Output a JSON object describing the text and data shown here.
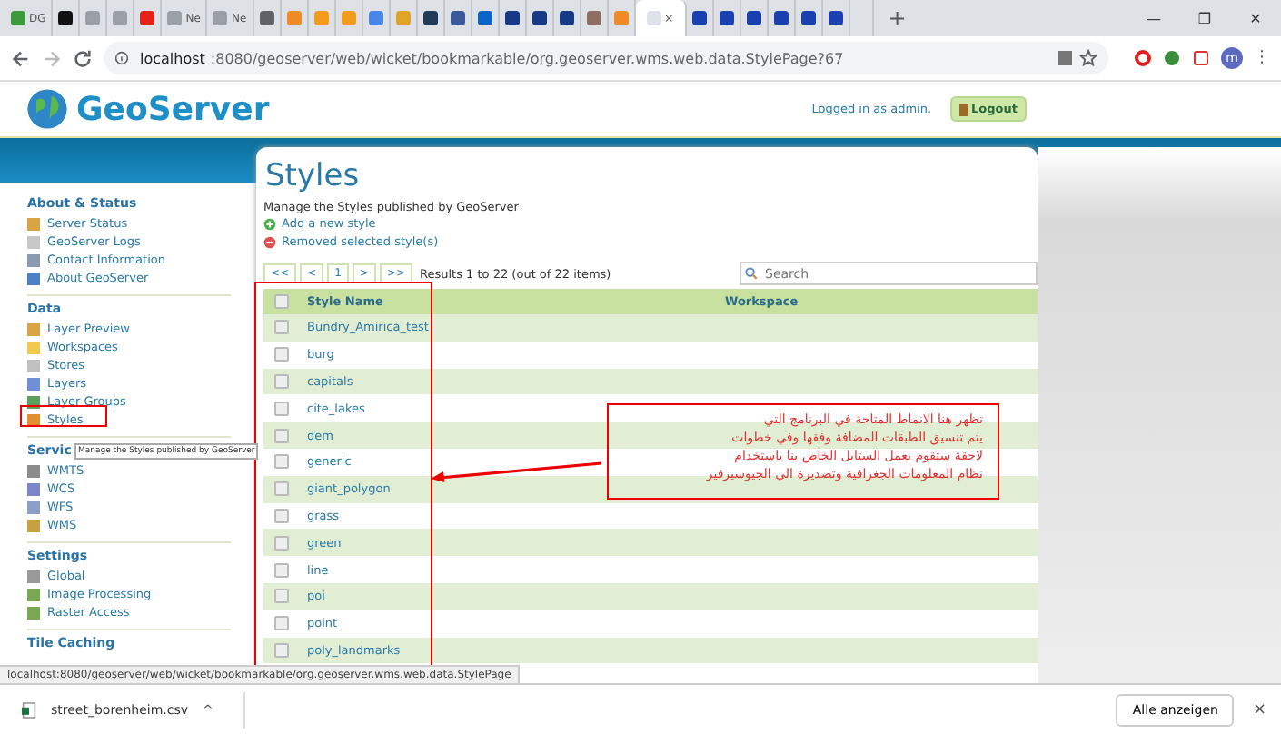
{
  "browser": {
    "tabs": [
      {
        "color": "#3c9a3c",
        "label": "DG",
        "selected": false
      },
      {
        "color": "#111111",
        "selected": false
      },
      {
        "color": "#9aa0a6",
        "selected": false
      },
      {
        "color": "#9aa0a6",
        "selected": false
      },
      {
        "color": "#e62117",
        "selected": false
      },
      {
        "color": "#9aa0a6",
        "label": "Ne",
        "selected": false
      },
      {
        "color": "#9aa0a6",
        "label": "Ne",
        "selected": false
      },
      {
        "color": "#5f6368",
        "selected": false
      },
      {
        "color": "#f08a24",
        "selected": false
      },
      {
        "color": "#f29b1d",
        "selected": false
      },
      {
        "color": "#f29b1d",
        "selected": false
      },
      {
        "color": "#4a86e8",
        "selected": false
      },
      {
        "color": "#e0a526",
        "selected": false
      },
      {
        "color": "#1f3b57",
        "selected": false
      },
      {
        "color": "#3b5998",
        "selected": false
      },
      {
        "color": "#0a64c8",
        "selected": false
      },
      {
        "color": "#173a87",
        "selected": false
      },
      {
        "color": "#173a87",
        "selected": false
      },
      {
        "color": "#173a87",
        "selected": false
      },
      {
        "color": "#8d6e63",
        "selected": false
      },
      {
        "color": "#f08a24",
        "selected": false
      },
      {
        "color": "#dfe3e8",
        "close": "×",
        "selected": true
      },
      {
        "color": "#1a3fb0",
        "selected": false
      },
      {
        "color": "#1a3fb0",
        "selected": false
      },
      {
        "color": "#1a3fb0",
        "selected": false
      },
      {
        "color": "#1a3fb0",
        "selected": false
      },
      {
        "color": "#1a3fb0",
        "selected": false
      },
      {
        "color": "#1a3fb0",
        "selected": false
      },
      {
        "selected": false
      }
    ],
    "new_tab": "+",
    "window_controls": [
      "—",
      "❐",
      "✕"
    ],
    "url_host": "localhost",
    "url_rest": ":8080/geoserver/web/wicket/bookmarkable/org.geoserver.wms.web.data.StylePage?67",
    "avatar": "m",
    "menu": "⋮"
  },
  "header": {
    "logo": "GeoServer",
    "logged_in": "Logged in as admin.",
    "logout": "Logout"
  },
  "sidebar": [
    {
      "title": "About & Status",
      "items": [
        {
          "label": "Server Status",
          "color": "#d9a441"
        },
        {
          "label": "GeoServer Logs",
          "color": "#c8c8c8"
        },
        {
          "label": "Contact Information",
          "color": "#8a9bb0"
        },
        {
          "label": "About GeoServer",
          "color": "#4d7fc4"
        }
      ]
    },
    {
      "title": "Data",
      "items": [
        {
          "label": "Layer Preview",
          "color": "#d9a441"
        },
        {
          "label": "Workspaces",
          "color": "#f2c94c"
        },
        {
          "label": "Stores",
          "color": "#c0c0c0"
        },
        {
          "label": "Layers",
          "color": "#6f8fd6"
        },
        {
          "label": "Layer Groups",
          "color": "#5aa05a"
        },
        {
          "label": "Styles",
          "color": "#e2902e"
        }
      ]
    },
    {
      "title": "Servic",
      "items": [
        {
          "label": "WMTS",
          "color": "#8c8c8c"
        },
        {
          "label": "WCS",
          "color": "#7a86c8"
        },
        {
          "label": "WFS",
          "color": "#8aa0c8"
        },
        {
          "label": "WMS",
          "color": "#c8a040"
        }
      ]
    },
    {
      "title": "Settings",
      "items": [
        {
          "label": "Global",
          "color": "#9a9a9a"
        },
        {
          "label": "Image Processing",
          "color": "#7aa850"
        },
        {
          "label": "Raster Access",
          "color": "#7aa850"
        }
      ]
    },
    {
      "title": "Tile Caching"
    }
  ],
  "tooltip": "Manage the Styles published by GeoServer",
  "content": {
    "title": "Styles",
    "description": "Manage the Styles published by GeoServer",
    "actions": [
      {
        "label": "Add a new style",
        "kind": "add"
      },
      {
        "label": "Removed selected style(s)",
        "kind": "remove"
      }
    ],
    "pager": [
      "<<",
      "<",
      "1",
      ">",
      ">>"
    ],
    "results": "Results 1 to 22 (out of 22 items)",
    "search": {
      "placeholder": "Search"
    },
    "table": {
      "columns": [
        "Style Name",
        "Workspace"
      ],
      "header_checked": false,
      "rows": [
        {
          "name": "Bundry_Amirica_test",
          "checked": false
        },
        {
          "name": "burg",
          "checked": false
        },
        {
          "name": "capitals",
          "checked": false
        },
        {
          "name": "cite_lakes",
          "checked": false
        },
        {
          "name": "dem",
          "checked": false
        },
        {
          "name": "generic",
          "checked": false
        },
        {
          "name": "giant_polygon",
          "checked": false
        },
        {
          "name": "grass",
          "checked": false
        },
        {
          "name": "green",
          "checked": false
        },
        {
          "name": "line",
          "checked": false
        },
        {
          "name": "poi",
          "checked": false
        },
        {
          "name": "point",
          "checked": false
        },
        {
          "name": "poly_landmarks",
          "checked": false
        }
      ]
    }
  },
  "annotation": {
    "lines": [
      "تظهر هنا   الانماط  المتاحة في البرنامج  التي",
      "يتم   تنسيق الطبقات المضافة وفقها  وفي خطوات",
      "لاحقة ستقوم بعمل الستايل الخاص  بنا  باستخدام",
      "نظام   المعلومات الجغرافية  وتصديرة الي الجيوسيرفير"
    ]
  },
  "status_url": "localhost:8080/geoserver/web/wicket/bookmarkable/org.geoserver.wms.web.data.StylePage",
  "downloads": {
    "file": "street_borenheim.csv",
    "caret": "^",
    "show_all": "Alle anzeigen",
    "close": "×"
  }
}
